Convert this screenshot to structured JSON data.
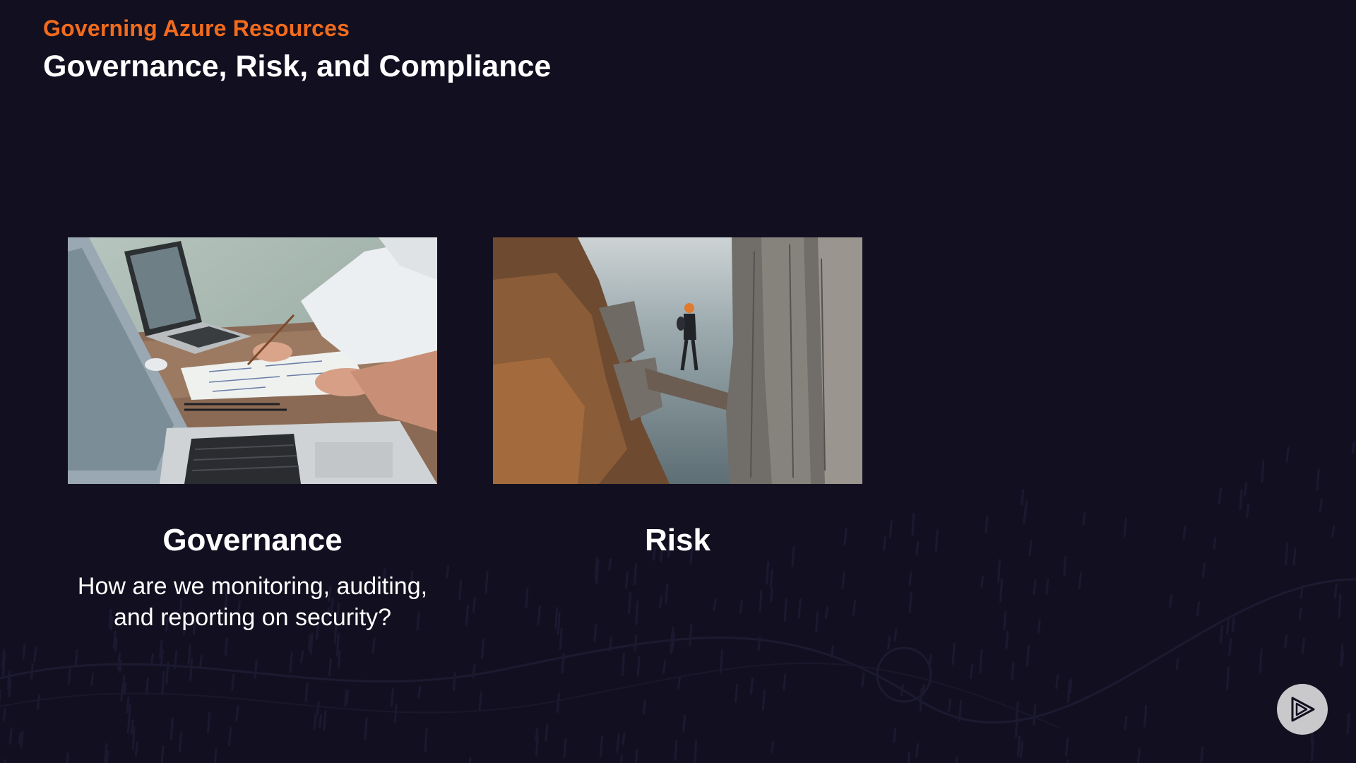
{
  "header": {
    "course_title": "Governing Azure Resources",
    "slide_title": "Governance, Risk, and Compliance"
  },
  "cards": [
    {
      "heading": "Governance",
      "description_lines": [
        "How are we monitoring, auditing,",
        "and reporting on security?"
      ],
      "image": "people-reviewing-documents-at-laptops-photo"
    },
    {
      "heading": "Risk",
      "description_lines": [],
      "image": "hiker-on-cliff-ledge-photo"
    }
  ],
  "branding": {
    "logo_icon": "pluralsight-play-logo-icon"
  },
  "colors": {
    "background": "#121020",
    "accent": "#f26b1d",
    "text": "#ffffff"
  }
}
